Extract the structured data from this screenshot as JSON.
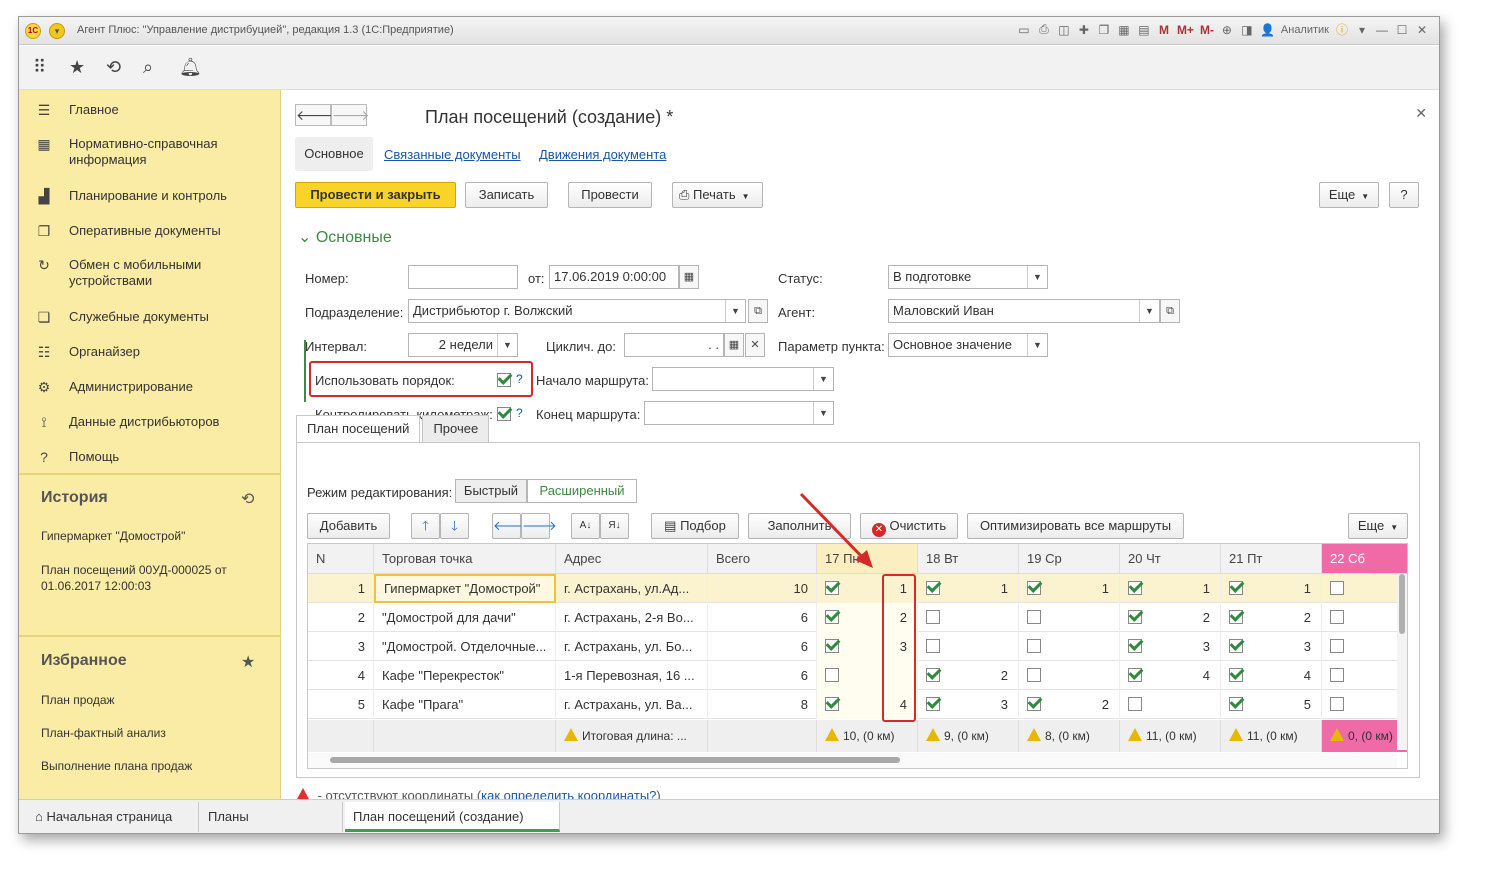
{
  "window": {
    "title": "Агент Плюс: \"Управление дистрибуцией\", редакция 1.3  (1С:Предприятие)",
    "user": "Аналитик",
    "logo": "1С"
  },
  "sidebar": {
    "items": [
      {
        "icon": "menu-icon",
        "glyph": "☰",
        "label": "Главное"
      },
      {
        "icon": "grid-icon",
        "glyph": "▦",
        "label": "Нормативно-справочная информация"
      },
      {
        "icon": "chart-icon",
        "glyph": "▟",
        "label": "Планирование и контроль"
      },
      {
        "icon": "documents-icon",
        "glyph": "❐",
        "label": "Оперативные документы"
      },
      {
        "icon": "sync-icon",
        "glyph": "↻",
        "label": "Обмен с мобильными устройствами"
      },
      {
        "icon": "document-icon",
        "glyph": "❏",
        "label": "Служебные документы"
      },
      {
        "icon": "list-icon",
        "glyph": "☷",
        "label": "Органайзер"
      },
      {
        "icon": "gear-icon",
        "glyph": "⚙",
        "label": "Администрирование"
      },
      {
        "icon": "distributor-icon",
        "glyph": "⟟",
        "label": "Данные дистрибьюторов"
      },
      {
        "icon": "help-icon",
        "glyph": "?",
        "label": "Помощь"
      }
    ],
    "history_title": "История",
    "history": [
      "Гипермаркет \"Домострой\"",
      "План посещений 00УД-000025 от 01.06.2017 12:00:03"
    ],
    "favorites_title": "Избранное",
    "favorites": [
      "План продаж",
      "План-фактный анализ",
      "Выполнение плана продаж"
    ]
  },
  "form": {
    "title": "План посещений  (создание) *",
    "tabs": {
      "main": "Основное",
      "related": "Связанные документы",
      "movements": "Движения документа"
    },
    "buttons": {
      "post_close": "Провести и закрыть",
      "save": "Записать",
      "post": "Провести",
      "print": "Печать",
      "more": "Еще",
      "help": "?"
    },
    "group_title": "Основные",
    "fields": {
      "number_label": "Номер:",
      "number_value": "",
      "date_label": "от:",
      "date_value": "17.06.2019  0:00:00",
      "status_label": "Статус:",
      "status_value": "В подготовке",
      "division_label": "Подразделение:",
      "division_value": "Дистрибьютор г. Волжский",
      "agent_label": "Агент:",
      "agent_value": "Маловский Иван",
      "interval_label": "Интервал:",
      "interval_value": "2 недели",
      "cyclic_label": "Циклич. до:",
      "cyclic_value": "  .  .",
      "param_label": "Параметр пункта:",
      "param_value": "Основное значение",
      "use_order_label": "Использовать порядок:",
      "use_order_checked": true,
      "route_start_label": "Начало маршрута:",
      "route_start_value": "",
      "mileage_label": "Контролировать километраж:",
      "mileage_checked": true,
      "route_end_label": "Конец маршрута:",
      "route_end_value": ""
    }
  },
  "subtabs": {
    "plan": "План посещений",
    "other": "Прочее"
  },
  "edit_mode": {
    "label": "Режим редактирования:",
    "fast": "Быстрый",
    "extended": "Расширенный"
  },
  "grid_toolbar": {
    "add": "Добавить",
    "pick": "Подбор",
    "fill": "Заполнить",
    "clear": "Очистить",
    "optimize": "Оптимизировать все маршруты",
    "more": "Еще"
  },
  "grid": {
    "columns": {
      "n": "N",
      "point": "Торговая точка",
      "address": "Адрес",
      "total": "Всего"
    },
    "days": [
      "17 Пн",
      "18 Вт",
      "19 Ср",
      "20 Чт",
      "21 Пт",
      "22 Сб"
    ],
    "rows": [
      {
        "n": "1",
        "point": "Гипермаркет \"Домострой\"",
        "address": "г. Астрахань, ул.Ад...",
        "total": "10",
        "days": [
          [
            true,
            "1"
          ],
          [
            true,
            "1"
          ],
          [
            true,
            "1"
          ],
          [
            true,
            "1"
          ],
          [
            true,
            "1"
          ],
          [
            false,
            ""
          ]
        ]
      },
      {
        "n": "2",
        "point": "\"Домострой для дачи\"",
        "address": "г. Астрахань, 2-я Во...",
        "total": "6",
        "days": [
          [
            true,
            "2"
          ],
          [
            false,
            ""
          ],
          [
            false,
            ""
          ],
          [
            true,
            "2"
          ],
          [
            true,
            "2"
          ],
          [
            false,
            ""
          ]
        ]
      },
      {
        "n": "3",
        "point": "\"Домострой. Отделочные...",
        "address": "г. Астрахань, ул. Бо...",
        "total": "6",
        "days": [
          [
            true,
            "3"
          ],
          [
            false,
            ""
          ],
          [
            false,
            ""
          ],
          [
            true,
            "3"
          ],
          [
            true,
            "3"
          ],
          [
            false,
            ""
          ]
        ]
      },
      {
        "n": "4",
        "point": "Кафе \"Перекресток\"",
        "address": "1-я Перевозная, 16 ...",
        "total": "6",
        "days": [
          [
            false,
            ""
          ],
          [
            true,
            "2"
          ],
          [
            false,
            ""
          ],
          [
            true,
            "4"
          ],
          [
            true,
            "4"
          ],
          [
            false,
            ""
          ]
        ]
      },
      {
        "n": "5",
        "point": "Кафе \"Прага\"",
        "address": "г. Астрахань, ул. Ва...",
        "total": "8",
        "days": [
          [
            true,
            "4"
          ],
          [
            true,
            "3"
          ],
          [
            true,
            "2"
          ],
          [
            false,
            ""
          ],
          [
            true,
            "5"
          ],
          [
            false,
            ""
          ]
        ]
      }
    ],
    "footer_total": "Итоговая длина: ...",
    "footer_days": [
      "10, (0 км)",
      "9, (0 км)",
      "8, (0 км)",
      "11, (0 км)",
      "11, (0 км)",
      "0, (0 км)"
    ]
  },
  "note": {
    "text": " - отсутствуют координаты (",
    "link": "как определить координаты?",
    "close": ")"
  },
  "bottom_tabs": [
    "Начальная страница",
    "Планы посещений",
    "План посещений  (создание) *"
  ],
  "colors": {
    "sidebar": "#fbeca5",
    "accent": "#fad328",
    "green": "#3d8a46",
    "highlight": "#d42a2a",
    "weekend": "#f06aa8"
  }
}
